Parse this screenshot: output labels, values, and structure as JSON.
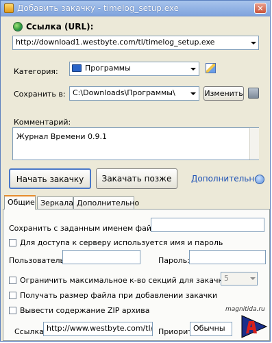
{
  "window": {
    "title": "Добавить закачку - timelog_setup.exe",
    "close_glyph": "✕"
  },
  "url": {
    "label": "Ссылка (URL):",
    "value": "http://download1.westbyte.com/tl/timelog_setup.exe"
  },
  "category": {
    "label": "Категория:",
    "value": "Программы"
  },
  "save": {
    "label": "Сохранить в:",
    "value": "C:\\Downloads\\Программы\\",
    "change_button": "Изменить"
  },
  "comment": {
    "label": "Комментарий:",
    "value": "Журнал Времени 0.9.1"
  },
  "actions": {
    "start": "Начать закачку",
    "later": "Закачать позже",
    "more": "Дополнительно"
  },
  "tabs": [
    {
      "label": "Общие"
    },
    {
      "label": "Зеркала"
    },
    {
      "label": "Дополнительно"
    }
  ],
  "general": {
    "save_as_label": "Сохранить с заданным именем файла:",
    "auth_checkbox": "Для доступа к серверу используется имя и пароль",
    "user_label": "Пользователь:",
    "password_label": "Пароль:",
    "limit_sections_checkbox": "Ограничить максимальное к-во секций для закачки",
    "sections_value": "5",
    "get_size_checkbox": "Получать размер файла при добавлении закачки",
    "zip_checkbox": "Вывести содержание ZIP архива",
    "link_label": "Ссылка:",
    "link_value": "http://www.westbyte.com/tl/ind",
    "priority_label": "Приоритет:",
    "priority_value": "Обычны"
  },
  "watermark": {
    "text": "magnitida.ru"
  },
  "icons": {
    "url": "globe-icon",
    "category": "folder-icon",
    "category_edit": "edit-icon",
    "save_disk": "disk-icon",
    "more": "expand-icon",
    "watermark": "logo-icon"
  },
  "colors": {
    "title_bar": "#7fa3dd",
    "tab_accent": "#e68b2c",
    "start_border": "#4a78c8",
    "link_blue": "#1a4fb4"
  }
}
